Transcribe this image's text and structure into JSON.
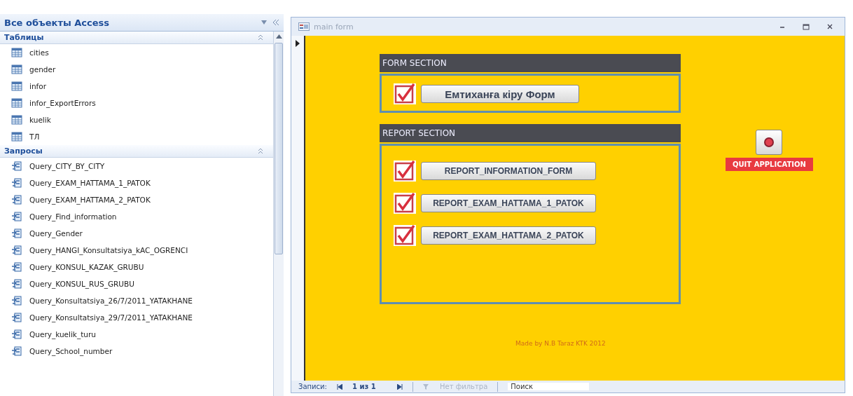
{
  "nav_pane": {
    "title": "Все объекты Access",
    "groups": [
      {
        "label": "Таблицы",
        "kind": "table",
        "items": [
          "cities",
          "gender",
          "infor",
          "infor_ExportErrors",
          "kuelik",
          "ТЛ"
        ]
      },
      {
        "label": "Запросы",
        "kind": "query",
        "items": [
          "Query_CITY_BY_CITY",
          "Query_EXAM_HATTAMA_1_PATOK",
          "Query_EXAM_HATTAMA_2_PATOK",
          "Query_Find_information",
          "Query_Gender",
          "Query_HANGI_Konsultatsiya_kAC_OGRENCI",
          "Query_KONSUL_KAZAK_GRUBU",
          "Query_KONSUL_RUS_GRUBU",
          "Query_Konsultatsiya_26/7/2011_YATAKHANE",
          "Query_Konsultatsiya_29/7/2011_YATAKHANE",
          "Query_kuelik_turu",
          "Query_School_number"
        ]
      }
    ]
  },
  "form_window": {
    "title": "main form",
    "sections": [
      {
        "title": "FORM SECTION",
        "kind": "form",
        "buttons": [
          {
            "label": "Емтиханға кіру Форм",
            "checked": true
          }
        ]
      },
      {
        "title": "REPORT SECTION",
        "kind": "report",
        "buttons": [
          {
            "label": "REPORT_INFORMATION_FORM",
            "checked": true
          },
          {
            "label": "REPORT_EXAM_HATTAMA_1_PATOK",
            "checked": true
          },
          {
            "label": "REPORT_EXAM_HATTAMA_2_PATOK",
            "checked": true
          }
        ]
      }
    ],
    "quit_button": {
      "label": "QUIT APPLICATION"
    },
    "footer": "Made by N.B Taraz KTK 2012",
    "record_nav": {
      "label": "Записи:",
      "position": "1 из 1",
      "filter": "Нет фильтра",
      "search": "Поиск"
    }
  }
}
